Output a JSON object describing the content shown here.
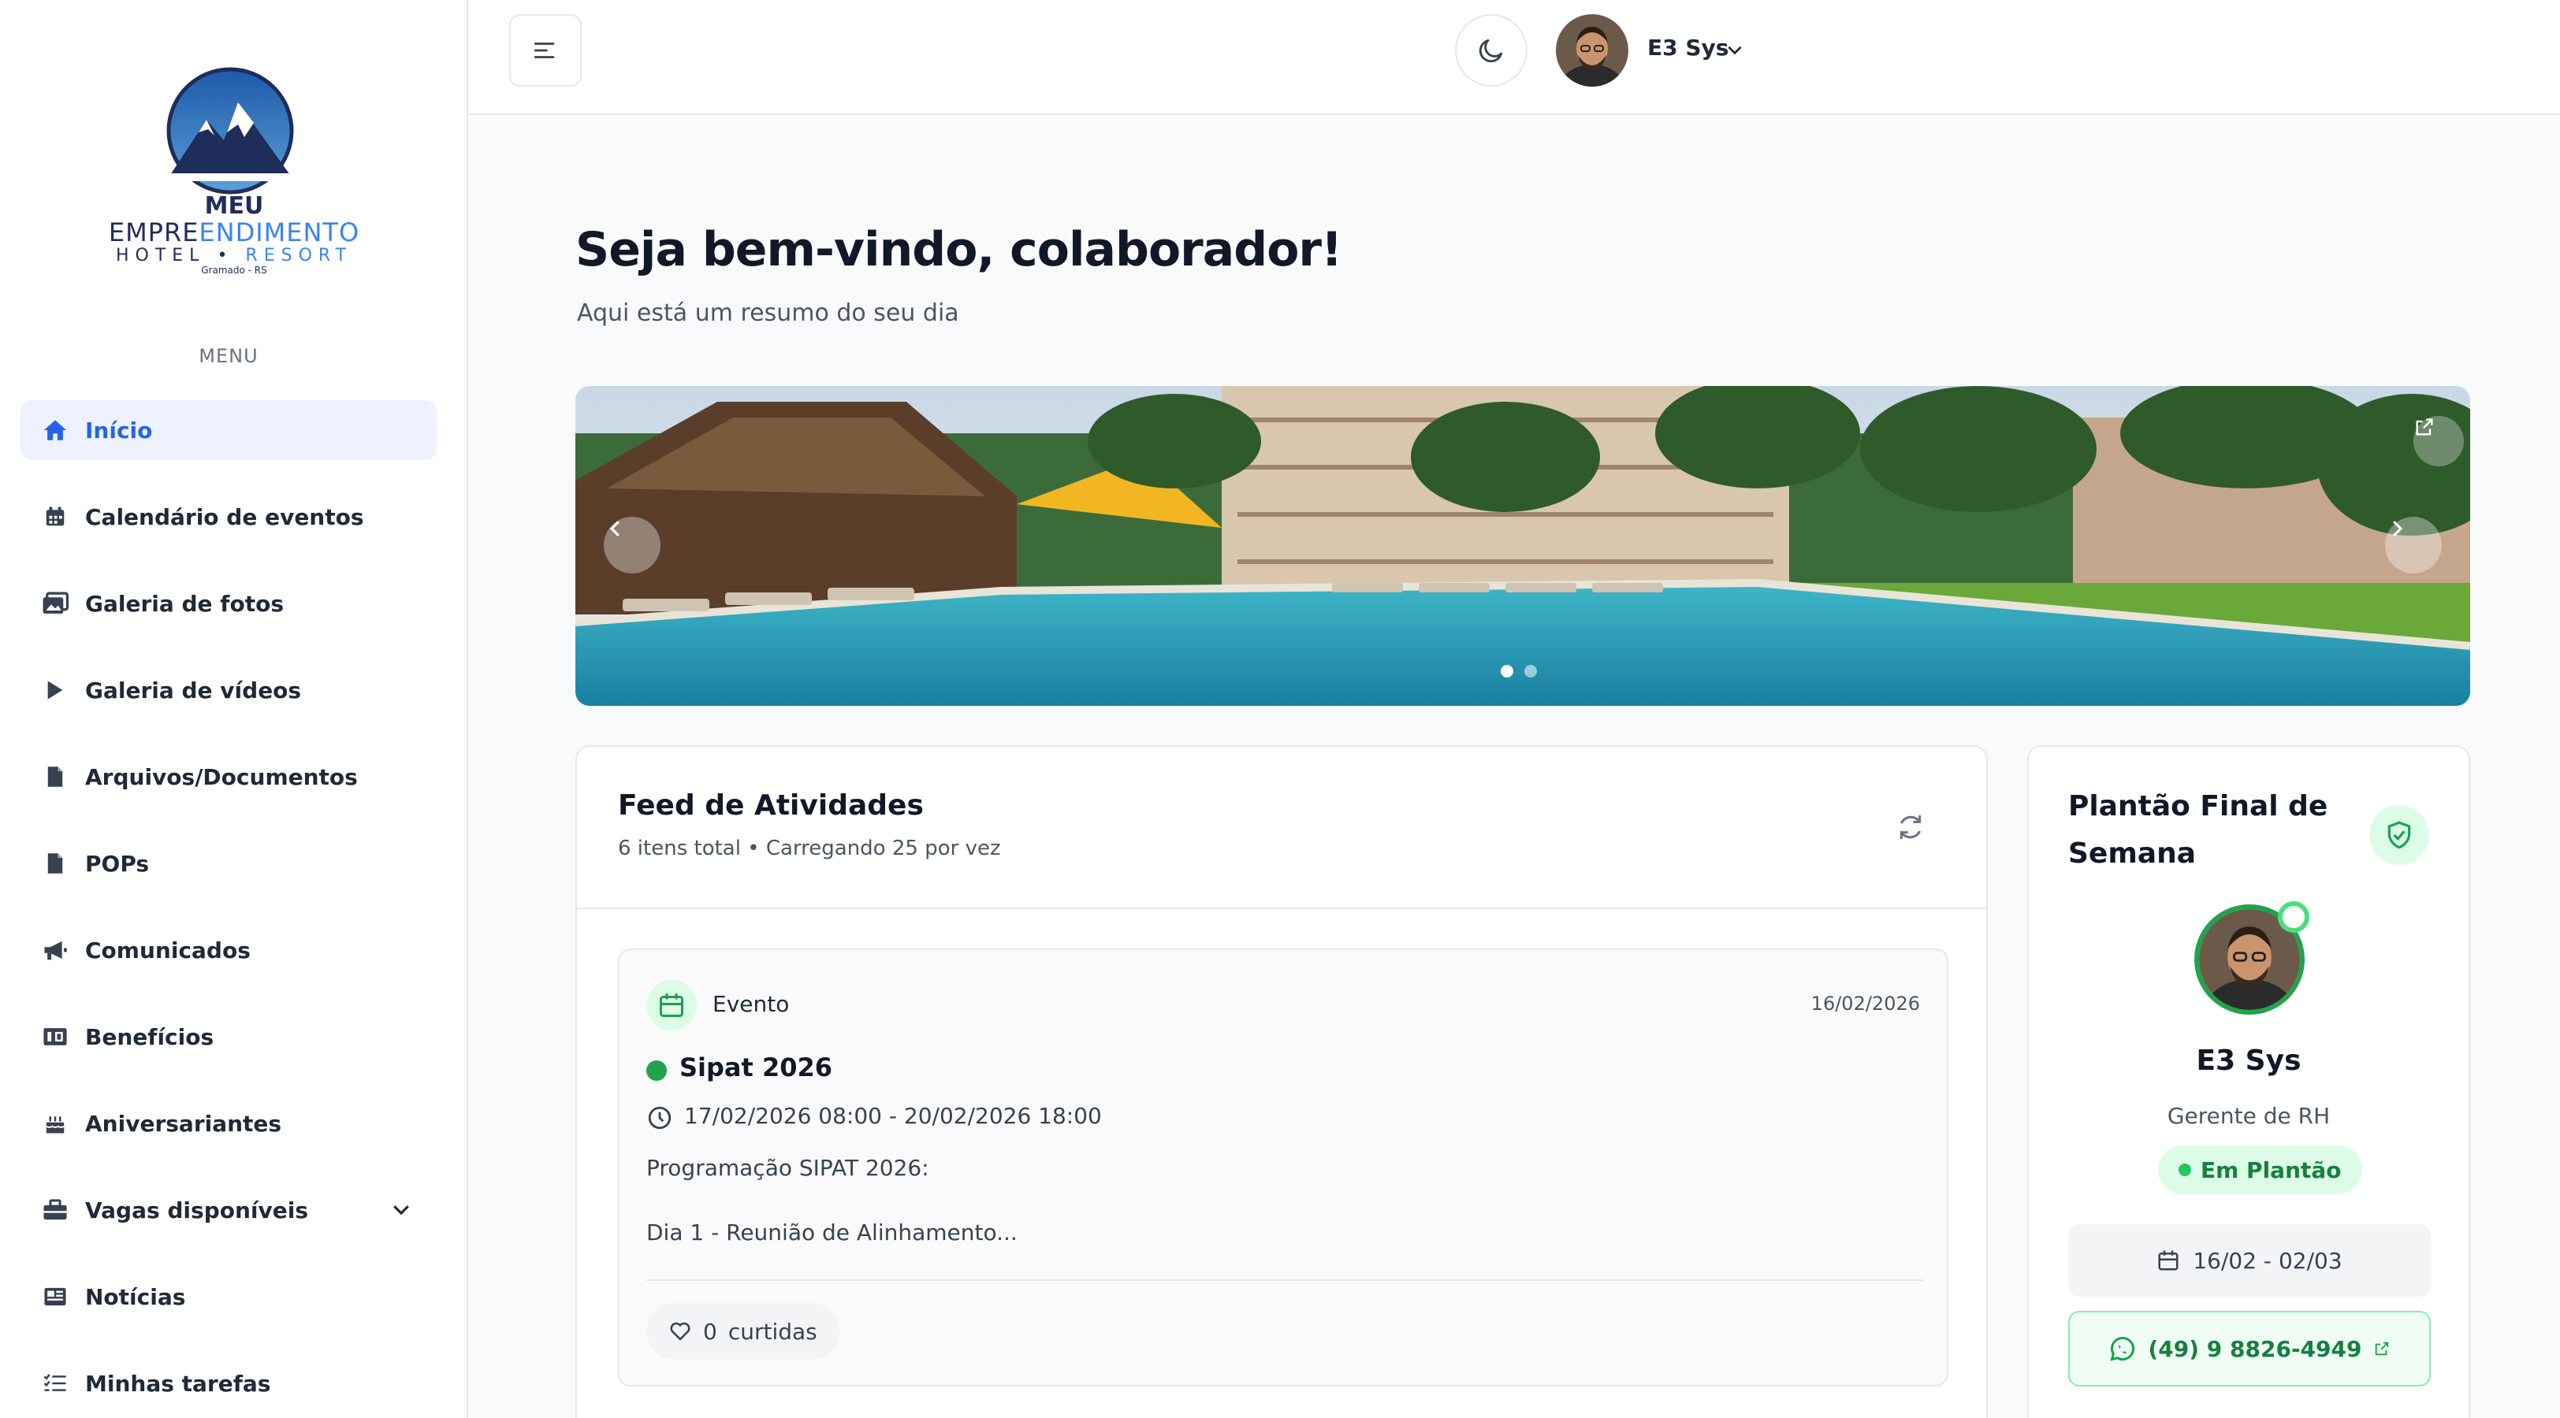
{
  "brand": {
    "line1": "MEU",
    "line2_a": "EMPRE",
    "line2_b": "ENDIMENTO",
    "line3_a": "HOTEL",
    "line3_b": "RESORT",
    "line4": "Gramado - RS"
  },
  "sidebar": {
    "menu_title": "MENU",
    "items": [
      {
        "label": "Início",
        "icon": "home-icon",
        "active": true
      },
      {
        "label": "Calendário de eventos",
        "icon": "calendar-icon"
      },
      {
        "label": "Galeria de fotos",
        "icon": "photos-icon"
      },
      {
        "label": "Galeria de vídeos",
        "icon": "play-icon"
      },
      {
        "label": "Arquivos/Documentos",
        "icon": "file-icon"
      },
      {
        "label": "POPs",
        "icon": "file-icon"
      },
      {
        "label": "Comunicados",
        "icon": "megaphone-icon"
      },
      {
        "label": "Benefícios",
        "icon": "benefits-icon"
      },
      {
        "label": "Aniversariantes",
        "icon": "cake-icon"
      },
      {
        "label": "Vagas disponíveis",
        "icon": "briefcase-icon"
      },
      {
        "label": "Notícias",
        "icon": "newspaper-icon"
      },
      {
        "label": "Minhas tarefas",
        "icon": "tasks-icon"
      }
    ]
  },
  "topbar": {
    "user_name": "E3 Sys"
  },
  "main": {
    "title": "Seja bem-vindo, colaborador!",
    "subtitle": "Aqui está um resumo do seu dia"
  },
  "banner": {
    "slides": 2,
    "active_slide": 1
  },
  "feed": {
    "title": "Feed de Atividades",
    "subtitle": "6 itens total • Carregando 25 por vez",
    "items": [
      {
        "type": "Evento",
        "date": "16/02/2026",
        "title": "Sipat 2026",
        "time": "17/02/2026 08:00 - 20/02/2026 18:00",
        "desc1": "Programação SIPAT 2026:",
        "desc2": "Dia 1 - Reunião de Alinhamento...",
        "likes_count": "0",
        "likes_label": "curtidas"
      }
    ]
  },
  "duty": {
    "title": "Plantão Final de Semana",
    "name": "E3 Sys",
    "role": "Gerente de RH",
    "status": "Em Plantão",
    "range": "16/02 - 02/03",
    "phone": "(49) 9 8826-4949"
  },
  "colors": {
    "accent": "#2563eb",
    "success": "#22a34a",
    "brand_navy": "#1f2d5a"
  }
}
